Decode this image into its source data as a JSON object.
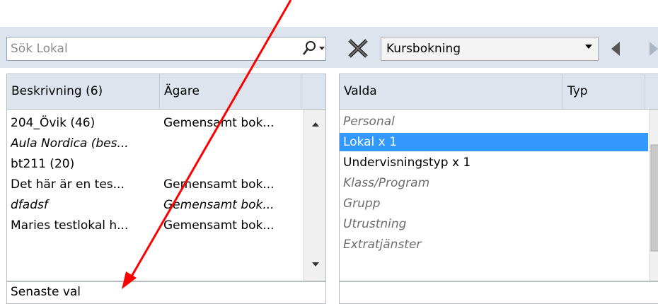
{
  "search": {
    "placeholder": "Sök Lokal"
  },
  "reservation_type": {
    "selected": "Kursbokning"
  },
  "left_table": {
    "columns": [
      "Beskrivning (6)",
      "Ägare"
    ],
    "rows": [
      {
        "description": "204_Övik (46)",
        "owner": "Gemensamt bok...",
        "style": "normal"
      },
      {
        "description": "Aula Nordica (bes...",
        "owner": "",
        "style": "italic"
      },
      {
        "description": "bt211 (20)",
        "owner": "",
        "style": "normal"
      },
      {
        "description": "Det här är en tes...",
        "owner": "Gemensamt bok...",
        "style": "normal"
      },
      {
        "description": "dfadsf",
        "owner": "Gemensamt bok...",
        "style": "italic"
      },
      {
        "description": "Maries testlokal h...",
        "owner": "Gemensamt bok...",
        "style": "normal"
      }
    ],
    "footer": "Senaste val"
  },
  "right_table": {
    "columns": [
      "Valda",
      "Typ"
    ],
    "rows": [
      {
        "label": "Personal",
        "state": "empty"
      },
      {
        "label": "Lokal x 1",
        "state": "selected"
      },
      {
        "label": "Undervisningstyp x 1",
        "state": "filled"
      },
      {
        "label": "Klass/Program",
        "state": "empty"
      },
      {
        "label": "Grupp",
        "state": "empty"
      },
      {
        "label": "Utrustning",
        "state": "empty"
      },
      {
        "label": "Extratjänster",
        "state": "empty"
      }
    ]
  },
  "annotation": {
    "color": "#ff0000"
  }
}
